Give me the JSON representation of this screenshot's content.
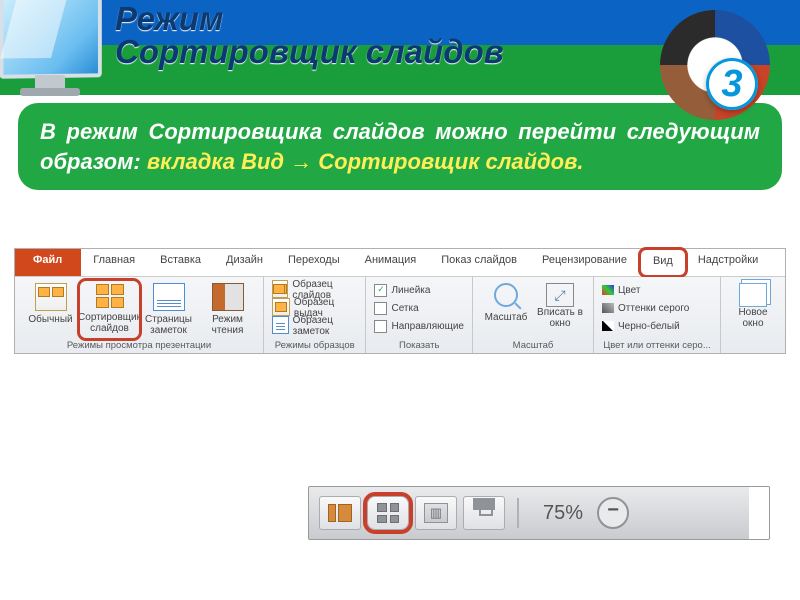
{
  "header": {
    "title_line1": "Режим",
    "title_line2": "Сортировщик слайдов",
    "badge_number": "3"
  },
  "description": {
    "prefix": "В режим Сортировщика слайдов можно перейти следующим образом: ",
    "highlight": "вкладка Вид → Сортировщик слайдов."
  },
  "ribbon": {
    "tabs": {
      "file": "Файл",
      "home": "Главная",
      "insert": "Вставка",
      "design": "Дизайн",
      "transitions": "Переходы",
      "animation": "Анимация",
      "slideshow": "Показ слайдов",
      "review": "Рецензирование",
      "view": "Вид",
      "addins": "Надстройки"
    },
    "groups": {
      "presentation_views": {
        "label": "Режимы просмотра презентации",
        "normal": "Обычный",
        "sorter": "Сортировщик слайдов",
        "notes": "Страницы заметок",
        "reading": "Режим чтения"
      },
      "master_views": {
        "label": "Режимы образцов",
        "slide_master": "Образец слайдов",
        "handout_master": "Образец выдач",
        "notes_master": "Образец заметок"
      },
      "show": {
        "label": "Показать",
        "ruler": "Линейка",
        "gridlines": "Сетка",
        "guides": "Направляющие"
      },
      "zoom": {
        "label": "Масштаб",
        "zoom": "Масштаб",
        "fit": "Вписать в окно"
      },
      "color": {
        "label": "Цвет или оттенки серо...",
        "color": "Цвет",
        "grayscale": "Оттенки серого",
        "blackwhite": "Черно-белый"
      },
      "window": {
        "new_window": "Новое окно"
      }
    }
  },
  "status_bar": {
    "zoom_percent": "75%"
  }
}
